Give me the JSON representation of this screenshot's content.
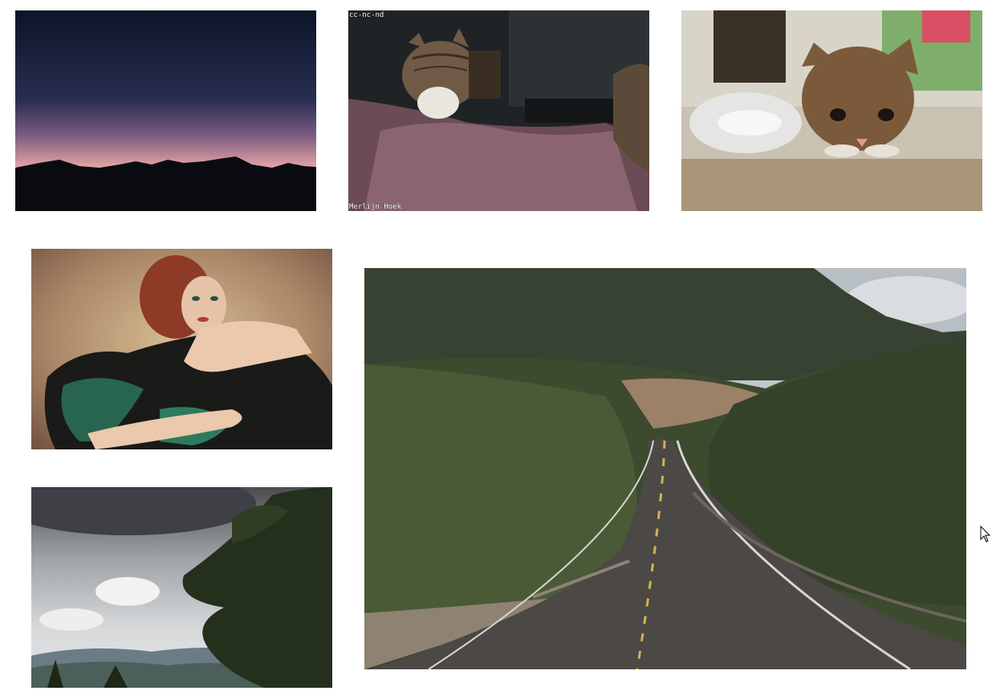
{
  "gallery": {
    "photos": [
      {
        "id": "mountains",
        "subject": "mountain-silhouette-dusk"
      },
      {
        "id": "cat",
        "subject": "tabby-cat-on-cushion",
        "overlay_top": "cc-nc-nd",
        "overlay_bottom": "Merlijn Hoek"
      },
      {
        "id": "kitten",
        "subject": "kitten-on-counter"
      },
      {
        "id": "woman",
        "subject": "woman-in-dress-portrait"
      },
      {
        "id": "trees",
        "subject": "pine-tree-cloudy-sky"
      },
      {
        "id": "road",
        "subject": "winding-mountain-road"
      }
    ]
  },
  "colors": {
    "background": "#ffffff",
    "sky_dusk_top": "#0e1626",
    "sky_dusk_glow": "#d99aa0",
    "road_asphalt": "#4a4744",
    "forest_green": "#3d4a30"
  },
  "cursor": {
    "icon": "arrow-pointer-icon"
  }
}
